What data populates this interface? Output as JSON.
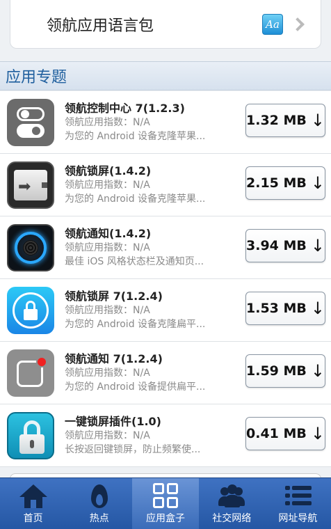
{
  "top_item": {
    "label": "领航应用语言包",
    "icon": "aa-font-icon",
    "icon_text": "Aa"
  },
  "section": {
    "title": "应用专题"
  },
  "apps": [
    {
      "name": "领航控制中心 7(1.2.3)",
      "rating": "领航应用指数：N/A",
      "desc": "为您的 Android 设备克隆苹果...",
      "size": "1.32 MB",
      "icon": "control-center-icon"
    },
    {
      "name": "领航锁屏(1.4.2)",
      "rating": "领航应用指数：N/A",
      "desc": "为您的 Android 设备克隆苹果...",
      "size": "2.15 MB",
      "icon": "slide-lock-icon"
    },
    {
      "name": "领航通知(1.4.2)",
      "rating": "领航应用指数：N/A",
      "desc": "最佳 iOS 风格状态栏及通知页...",
      "size": "3.94 MB",
      "icon": "speaker-notify-icon"
    },
    {
      "name": "领航锁屏 7(1.2.4)",
      "rating": "领航应用指数：N/A",
      "desc": "为您的 Android 设备克隆扁平...",
      "size": "1.53 MB",
      "icon": "lock-7-icon"
    },
    {
      "name": "领航通知 7(1.2.4)",
      "rating": "领航应用指数：N/A",
      "desc": "为您的 Android 设备提供扁平...",
      "size": "1.59 MB",
      "icon": "notify-7-icon"
    },
    {
      "name": "一键锁屏插件(1.0)",
      "rating": "领航应用指数：N/A",
      "desc": "长按返回键锁屏，防止频繁使...",
      "size": "0.41 MB",
      "icon": "one-key-lock-icon"
    }
  ],
  "download_arrow": "↓",
  "nav": [
    {
      "label": "首页",
      "icon": "home-icon"
    },
    {
      "label": "热点",
      "icon": "fire-icon"
    },
    {
      "label": "应用盒子",
      "icon": "grid-icon",
      "active": true
    },
    {
      "label": "社交网络",
      "icon": "people-icon"
    },
    {
      "label": "网址导航",
      "icon": "list-icon"
    }
  ],
  "colors": {
    "nav_bg": "#2f62b0",
    "section_text": "#1f5f9e",
    "accent": "#2aa8ff"
  }
}
